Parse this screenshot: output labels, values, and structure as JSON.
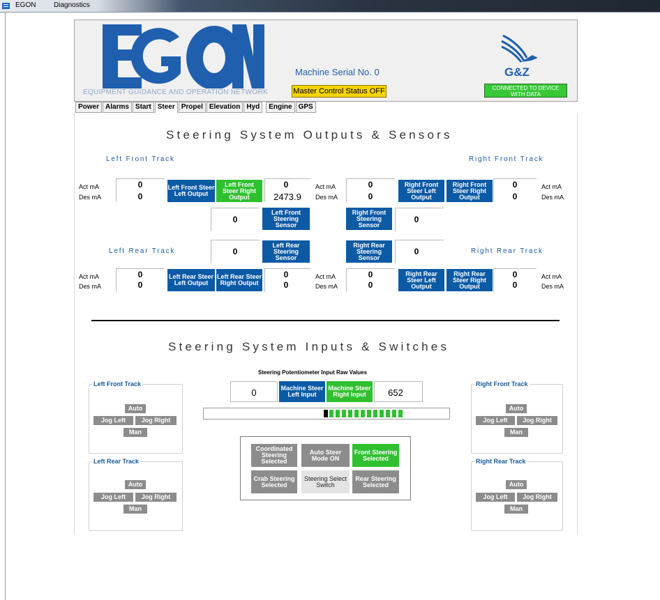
{
  "window": {
    "title": "EGON",
    "menu": "Diagnostics"
  },
  "header": {
    "logo_text": "EGON",
    "logo_subtitle": "EQUIPMENT GUIDANCE AND OPERATION NETWORK",
    "serial": "Machine Serial No. 0",
    "master_status": "Master Control Status OFF",
    "brand": "G&Z",
    "connection": "CONNECTED TO DEVICE WITH DATA"
  },
  "tabs": [
    "Power",
    "Alarms",
    "Start",
    "Steer",
    "Propel",
    "Elevation",
    "Hyd",
    "Engine",
    "GPS"
  ],
  "active_tab": "Steer",
  "outputs": {
    "title": "Steering System Outputs & Sensors",
    "left_front_label": "Left Front Track",
    "right_front_label": "Right Front Track",
    "left_rear_label": "Left Rear Track",
    "right_rear_label": "Right Rear Track",
    "act_label": "Act mA",
    "des_label": "Des mA",
    "lf": {
      "act": "0",
      "des": "0",
      "steer_left": "Left Front Steer Left Output",
      "steer_right": "Left Front Steer Right Output",
      "right_act": "0",
      "right_des": "2473.9",
      "sensor": "Left Front Steering Sensor",
      "sensor_value": "0"
    },
    "rf": {
      "act": "0",
      "des": "0",
      "steer_left": "Right Front Steer Left Output",
      "steer_right": "Right Front Steer Right Output",
      "right_act": "0",
      "right_des": "0",
      "sensor": "Right Front Steering Sensor",
      "sensor_value": "0"
    },
    "lr": {
      "act": "0",
      "des": "0",
      "steer_left": "Left Rear Steer Left Output",
      "steer_right": "Left Rear Steer Right Output",
      "right_act": "0",
      "right_des": "0",
      "sensor": "Left Rear Steering Sensor",
      "sensor_value": "0"
    },
    "rr": {
      "act": "0",
      "des": "0",
      "steer_left": "Right Rear Steer Left Output",
      "steer_right": "Right Rear Steer Right Output",
      "right_act": "0",
      "right_des": "0",
      "sensor": "Right Rear Steering Sensor",
      "sensor_value": "0"
    }
  },
  "inputs": {
    "title": "Steering System Inputs & Switches",
    "pot_label": "Steering Potentiometer Input Raw Values",
    "pot_left_value": "0",
    "pot_left_label": "Machine Steer Left Input",
    "pot_right_label": "Machine Steer Right Input",
    "pot_right_value": "652",
    "pot_bar_fill": 0.35,
    "groups": {
      "lf": "Left Front Track",
      "lr": "Left Rear Track",
      "rf": "Right Front Track",
      "rr": "Right Rear Track"
    },
    "auto": "Auto",
    "jog_left": "Jog Left",
    "jog_right": "Jog Right",
    "man": "Man",
    "modes": {
      "coordinated": "Coordinated Steering Selected",
      "auto_mode": "Auto Steer Mode ON",
      "front": "Front Steering Selected",
      "crab": "Crab Steering Selected",
      "select_switch": "Steering Select Switch",
      "rear": "Rear Steering Selected"
    }
  },
  "colors": {
    "blue": "#0b5aa6",
    "green": "#2fc02f",
    "gray": "#8c8c8c",
    "yellow": "#f5d400",
    "logo_blue": "#1f5fae"
  }
}
